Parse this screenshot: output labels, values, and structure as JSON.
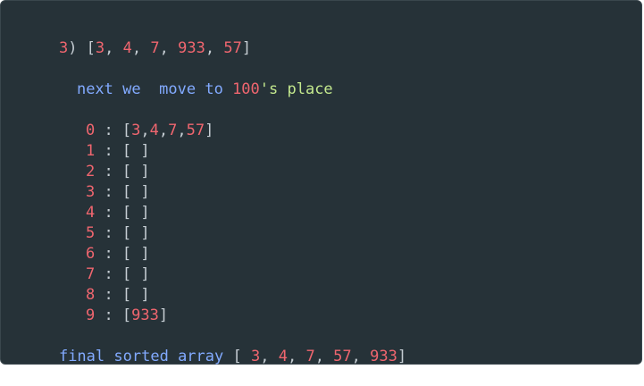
{
  "step_header": {
    "step": "3",
    "array": [
      "3",
      "4",
      "7",
      "933",
      "57"
    ]
  },
  "instruction": {
    "words": [
      "next",
      "we",
      "move",
      "to"
    ],
    "place_number": "100",
    "place_suffix": "'s place"
  },
  "buckets": [
    {
      "index": "0",
      "items": [
        "3",
        "4",
        "7",
        "57"
      ]
    },
    {
      "index": "1",
      "items": []
    },
    {
      "index": "2",
      "items": []
    },
    {
      "index": "3",
      "items": []
    },
    {
      "index": "4",
      "items": []
    },
    {
      "index": "5",
      "items": []
    },
    {
      "index": "6",
      "items": []
    },
    {
      "index": "7",
      "items": []
    },
    {
      "index": "8",
      "items": []
    },
    {
      "index": "9",
      "items": [
        "933"
      ]
    }
  ],
  "final": {
    "words": [
      "final",
      "sorted",
      "array"
    ],
    "array": [
      "3",
      "4",
      "7",
      "57",
      "933"
    ]
  },
  "colors": {
    "background": "#263238",
    "number": "#f0666f",
    "keyword": "#82aaff",
    "string": "#c3e88d",
    "punctuation": "#c5cdd3"
  }
}
